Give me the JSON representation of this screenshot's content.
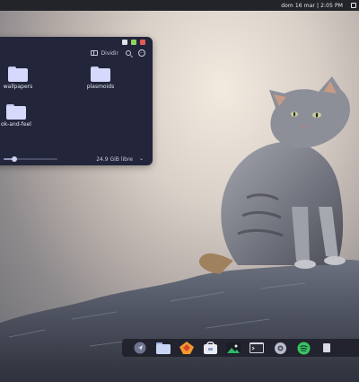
{
  "topbar": {
    "clock": "dom 16 mar | 2:05 PM"
  },
  "file_manager": {
    "toolbar": {
      "split_label": "Dividir"
    },
    "folders": [
      {
        "label": "wallpapers"
      },
      {
        "label": "plasmoids"
      },
      {
        "label": "ok-and-feel"
      }
    ],
    "status": {
      "free_space": "24.9 GiB libre",
      "zoom_level": 0.2
    }
  },
  "window_buttons": {
    "colors": [
      "#e25b5b",
      "#8fd45b",
      "#e0e0ec"
    ]
  },
  "dock": {
    "items": [
      {
        "icon": "launcher-icon"
      },
      {
        "icon": "files-icon"
      },
      {
        "icon": "firefox-icon"
      },
      {
        "icon": "store-icon"
      },
      {
        "icon": "image-viewer-icon"
      },
      {
        "icon": "terminal-icon"
      },
      {
        "icon": "settings-icon"
      },
      {
        "icon": "spotify-icon"
      },
      {
        "icon": "more-icon"
      }
    ]
  }
}
